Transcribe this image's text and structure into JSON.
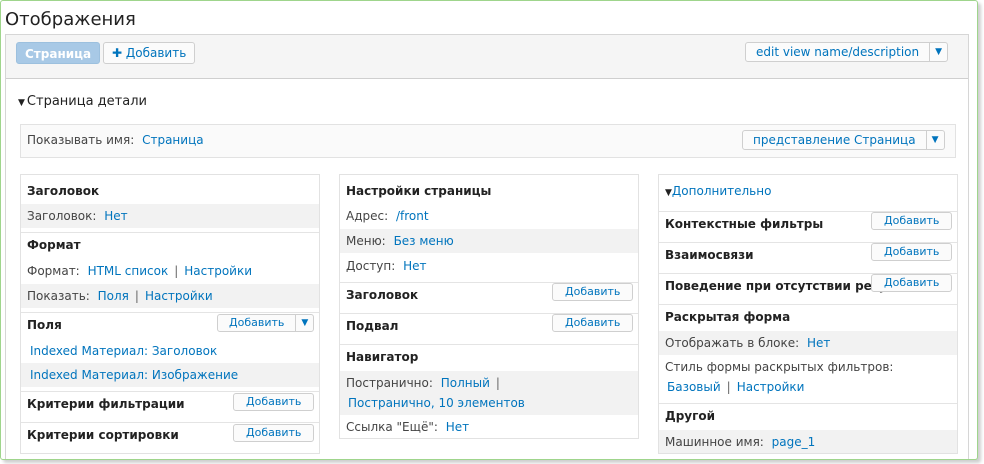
{
  "page": {
    "title": "Отображения"
  },
  "topbar": {
    "tab_active": "Страница",
    "add_label": "Добавить",
    "add_icon": "plus-icon",
    "edit_view_label": "edit view name/description",
    "dropdown_icon": "triangle-down-icon"
  },
  "details": {
    "header": "Страница детали",
    "show_name_label": "Показывать имя:",
    "show_name_value": "Страница",
    "representation_button": "представление Страница"
  },
  "left_col": {
    "title_head": "Заголовок",
    "title_label": "Заголовок:",
    "title_value": "Нет",
    "format_head": "Формат",
    "format_label": "Формат:",
    "format_value": "HTML список",
    "format_settings": "Настройки",
    "show_label": "Показать:",
    "show_value": "Поля",
    "show_settings": "Настройки",
    "fields_head": "Поля",
    "fields_add": "Добавить",
    "field1": "Indexed Материал: Заголовок",
    "field2": "Indexed Материал: Изображение",
    "filter_head": "Критерии фильтрации",
    "filter_add": "Добавить",
    "sort_head": "Критерии сортировки",
    "sort_add": "Добавить"
  },
  "mid_col": {
    "page_settings_head": "Настройки страницы",
    "address_label": "Адрес:",
    "address_value": "/front",
    "menu_label": "Меню:",
    "menu_value": "Без меню",
    "access_label": "Доступ:",
    "access_value": "Нет",
    "header_head": "Заголовок",
    "header_add": "Добавить",
    "footer_head": "Подвал",
    "footer_add": "Добавить",
    "pager_head": "Навигатор",
    "paged_label": "Постранично:",
    "paged_value": "Полный",
    "paged_items": "Постранично, 10 элементов",
    "more_label": "Ссылка \"Ещё\":",
    "more_value": "Нет"
  },
  "right_col": {
    "advanced_head": "Дополнительно",
    "context_head": "Контекстные фильтры",
    "context_add": "Добавить",
    "relations_head": "Взаимосвязи",
    "relations_add": "Добавить",
    "noresults_head": "Поведение при отсутствии резу",
    "noresults_add": "Добавить",
    "exposed_head": "Раскрытая форма",
    "exposed_block_label": "Отображать в блоке:",
    "exposed_block_value": "Нет",
    "exposed_style_label": "Стиль формы раскрытых фильтров:",
    "exposed_style_value": "Базовый",
    "exposed_style_settings": "Настройки",
    "other_head": "Другой",
    "machine_label": "Машинное имя:",
    "machine_value": "page_1"
  }
}
